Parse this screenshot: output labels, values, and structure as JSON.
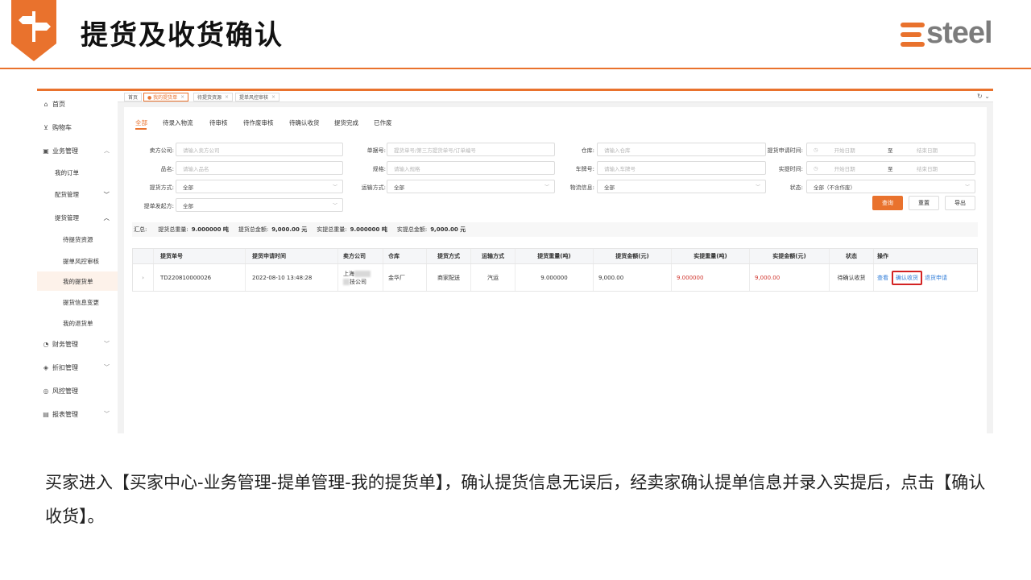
{
  "slide": {
    "title": "提货及收货确认",
    "logo_text": "steel",
    "caption": "买家进入【买家中心-业务管理-提单管理-我的提货单】，确认提货信息无误后，经卖家确认提单信息并录入实提后，点击【确认收货】。",
    "accent_color": "#e9722d"
  },
  "sidebar": {
    "home": "首页",
    "cart": "购物车",
    "business": "业务管理",
    "my_orders": "我的订单",
    "delivery_mgmt": "配货管理",
    "pickup_mgmt": "提货管理",
    "pending_pickup": "待提货资源",
    "bill_risk": "提单风控审核",
    "my_pickups": "我的提货单",
    "pickup_change": "提货信息变更",
    "my_returns": "我的退货单",
    "finance": "财务管理",
    "discount": "折扣管理",
    "risk": "风控管理",
    "reports": "报表管理"
  },
  "page_tabs": [
    {
      "label": "首页"
    },
    {
      "label": "● 我的提货单"
    },
    {
      "label": "待提货资源"
    },
    {
      "label": "提单风控审核"
    }
  ],
  "status_tabs": [
    "全部",
    "待录入物流",
    "待审核",
    "待作废审核",
    "待确认收货",
    "提货完成",
    "已作废"
  ],
  "filters": {
    "seller_label": "卖方公司:",
    "seller_ph": "请输入卖方公司",
    "billno_label": "单据号:",
    "billno_ph": "提货单号/第三方提货单号/订单编号",
    "warehouse_label": "仓库:",
    "warehouse_ph": "请输入仓库",
    "apply_time_label": "提货申请时间:",
    "product_label": "品名:",
    "product_ph": "请输入品名",
    "spec_label": "规格:",
    "spec_ph": "请输入规格",
    "plate_label": "车牌号:",
    "plate_ph": "请输入车牌号",
    "actual_time_label": "实提时间:",
    "start_ph": "开始日期",
    "to": "至",
    "end_ph": "结束日期",
    "method_label": "提货方式:",
    "method_val": "全部",
    "transport_label": "运输方式:",
    "transport_val": "全部",
    "logistics_label": "物流信息:",
    "logistics_val": "全部",
    "status_label": "状态:",
    "status_val": "全部（不含作废）",
    "initiator_label": "提单发起方:",
    "initiator_val": "全部",
    "query_btn": "查询",
    "reset_btn": "重置",
    "export_btn": "导出"
  },
  "summary": {
    "title": "汇总:",
    "pick_weight_label": "提货总重量:",
    "pick_weight": "9.000000 吨",
    "pick_amount_label": "提货总金额:",
    "pick_amount": "9,000.00 元",
    "actual_weight_label": "实提总重量:",
    "actual_weight": "9.000000 吨",
    "actual_amount_label": "实提总金额:",
    "actual_amount": "9,000.00 元"
  },
  "table": {
    "headers": [
      "提货单号",
      "提货申请时间",
      "卖方公司",
      "仓库",
      "提货方式",
      "运输方式",
      "提货重量(吨)",
      "提货金额(元)",
      "实提重量(吨)",
      "实提金额(元)",
      "状态",
      "操作"
    ],
    "row": {
      "expand": "›",
      "bill_no": "TD220810000026",
      "apply_time": "2022-08-10 13:48:28",
      "seller_line1": "上海",
      "seller_line2": "技公司",
      "warehouse": "金华厂",
      "pickup_method": "商家配送",
      "transport": "汽运",
      "pick_weight": "9.000000",
      "pick_amount": "9,000.00",
      "actual_weight": "9.000000",
      "actual_amount": "9,000.00",
      "status": "待确认收货",
      "action_view": "查看",
      "action_confirm": "确认收货",
      "action_return": "退货申请"
    }
  }
}
